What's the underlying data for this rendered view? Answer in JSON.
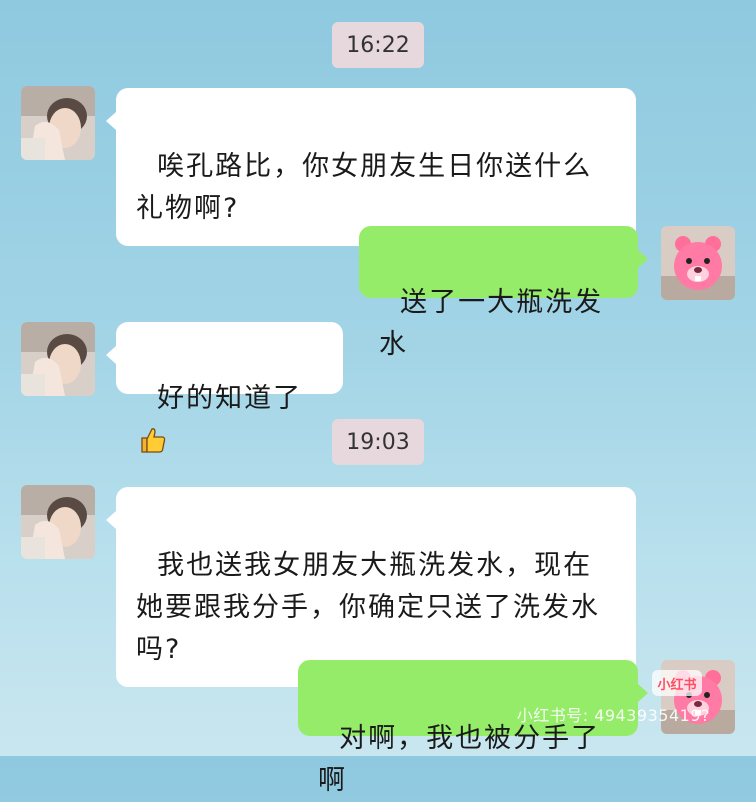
{
  "chat": {
    "time1": "16:22",
    "time2": "19:03",
    "messages": [
      {
        "side": "left",
        "text": "唉孔路比，你女朋友生日你送什么礼物啊?"
      },
      {
        "side": "right",
        "text": "送了一大瓶洗发水"
      },
      {
        "side": "left",
        "text": "好的知道了",
        "emoji": "thumbs-up-emoji"
      },
      {
        "side": "left",
        "text": "我也送我女朋友大瓶洗发水，现在她要跟我分手，你确定只送了洗发水吗?"
      },
      {
        "side": "right",
        "text": "对啊，我也被分手了啊"
      }
    ]
  },
  "watermark": {
    "logo_text": "小红书",
    "id_text": "小红书号: 4943935419?"
  },
  "colors": {
    "sent_bubble": "#95ec69",
    "received_bubble": "#ffffff",
    "time_pill": "#e6d8dc"
  },
  "icons": {
    "friend_avatar": "person-covering-face-avatar",
    "self_avatar": "pink-beaver-avatar"
  }
}
